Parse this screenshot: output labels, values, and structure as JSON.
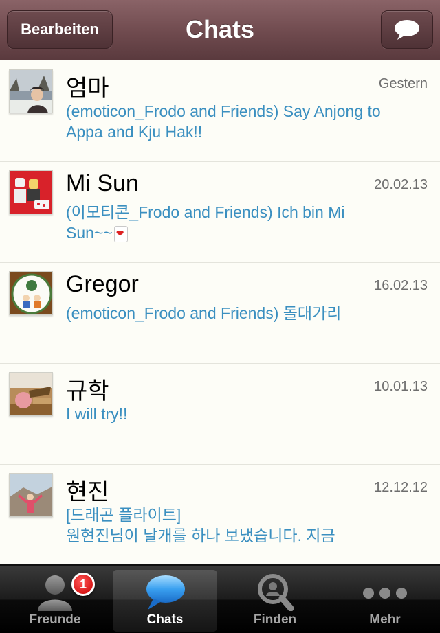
{
  "navbar": {
    "edit_label": "Bearbeiten",
    "title": "Chats",
    "compose_icon": "speech-bubble-icon"
  },
  "chats": [
    {
      "name": "엄마",
      "time": "Gestern",
      "message": "(emoticon_Frodo and Friends) Say Anjong to\nAppa and Kju Hak!!",
      "avatar": "photo-winter"
    },
    {
      "name": "Mi Sun",
      "time": "20.02.13",
      "message": "(이모티콘_Frodo and Friends) Ich bin Mi\nSun~~",
      "emoji": "heart-card",
      "avatar": "photo-lego"
    },
    {
      "name": "Gregor",
      "time": "16.02.13",
      "message": "(emoticon_Frodo and Friends) 돌대가리",
      "avatar": "photo-badge"
    },
    {
      "name": "규학",
      "time": "10.01.13",
      "message": "I will try!!",
      "avatar": "photo-bowl"
    },
    {
      "name": "현진",
      "time": "12.12.12",
      "message": "[드래곤 플라이트]\n원현진님이 날개를 하나 보냈습니다. 지금",
      "avatar": "photo-mountain"
    }
  ],
  "tabbar": {
    "tabs": [
      {
        "label": "Freunde",
        "icon": "person-icon",
        "badge": "1"
      },
      {
        "label": "Chats",
        "icon": "chat-bubble-icon",
        "active": true
      },
      {
        "label": "Finden",
        "icon": "magnifier-icon"
      },
      {
        "label": "Mehr",
        "icon": "more-dots-icon"
      }
    ]
  },
  "colors": {
    "navbar": "#6f4a4e",
    "message_text": "#3a8fc0",
    "badge": "#d40000",
    "background": "#fdfdf7"
  }
}
